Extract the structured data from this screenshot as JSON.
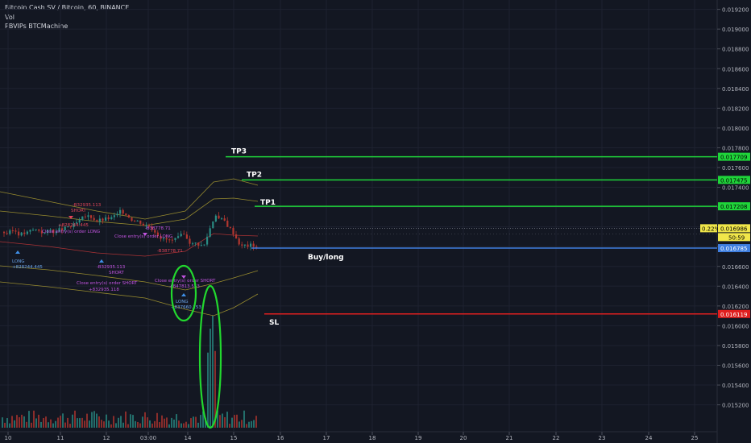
{
  "header": {
    "symbol_line": "Bitcoin Cash SV / Bitcoin, 60, BINANCE",
    "vol_label": "Vol",
    "indicator_label": "PBVIPs BTCMachine"
  },
  "colors": {
    "background": "#131722",
    "grid": "#1e2230",
    "axis_text": "#b2b5be",
    "tp_line": "#1fd43a",
    "entry_line": "#3f7fe0",
    "sl_line": "#e01f1f",
    "candle_up": "#2a8c84",
    "candle_down": "#b2362f",
    "annotation_text": "#c254e0",
    "annotation_text_red": "#e0455a",
    "highlight_ellipse": "#22d82e"
  },
  "chart_data": {
    "type": "candlestick",
    "y_axis": {
      "ticks": [
        "0.019200",
        "0.019000",
        "0.018800",
        "0.018600",
        "0.018400",
        "0.018200",
        "0.018000",
        "0.017800",
        "0.017600",
        "0.017400",
        "0.017200",
        "0.017000",
        "0.016800",
        "0.016600",
        "0.016400",
        "0.016200",
        "0.016000",
        "0.015800",
        "0.015600",
        "0.015400",
        "0.015200"
      ],
      "range": [
        0.0151,
        0.0193
      ]
    },
    "x_axis": {
      "labels": [
        "10",
        "11",
        "12",
        "03:00",
        "14",
        "15",
        "16",
        "17",
        "18",
        "19",
        "20",
        "21",
        "22",
        "23",
        "24",
        "25"
      ]
    },
    "levels": [
      {
        "name": "TP3",
        "value": 0.017709,
        "label": "0.017709"
      },
      {
        "name": "TP2",
        "value": 0.017475,
        "label": "0.017475"
      },
      {
        "name": "TP1",
        "value": 0.017208,
        "label": "0.017208"
      },
      {
        "name": "Buy/long",
        "value": 0.016785,
        "label": "0.016785"
      },
      {
        "name": "SL",
        "value": 0.016119,
        "label": "0.016119"
      }
    ],
    "current_price": {
      "value": 0.016986,
      "label": "0.016986",
      "change": "0.22%",
      "countdown": "50:59"
    },
    "annotations": [
      "-B32935.113",
      "SHORT",
      "+828244.445",
      "Close entry(s) order LONG",
      "LONG",
      "+828244.445",
      "-B32935.113",
      "SHORT",
      "Close entry(s) order SHORT",
      "+832935.118",
      "-B38778.71",
      "Close entry(s) order LONG",
      "-B38778.71",
      "Close entry(s) order SHORT",
      "+847813.553",
      "LONG",
      "+837660.153"
    ]
  }
}
